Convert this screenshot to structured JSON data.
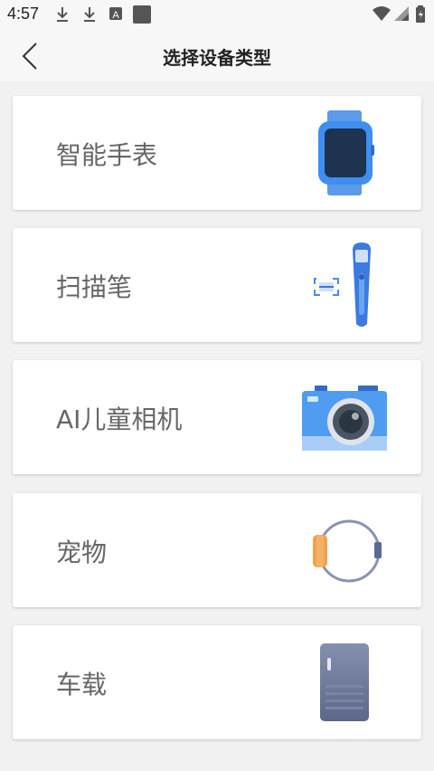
{
  "status_bar": {
    "time": "4:57"
  },
  "header": {
    "title": "选择设备类型"
  },
  "devices": [
    {
      "label": "智能手表",
      "icon": "smartwatch-icon"
    },
    {
      "label": "扫描笔",
      "icon": "scan-pen-icon"
    },
    {
      "label": "AI儿童相机",
      "icon": "camera-icon"
    },
    {
      "label": "宠物",
      "icon": "pet-collar-icon"
    },
    {
      "label": "车载",
      "icon": "car-device-icon"
    }
  ]
}
